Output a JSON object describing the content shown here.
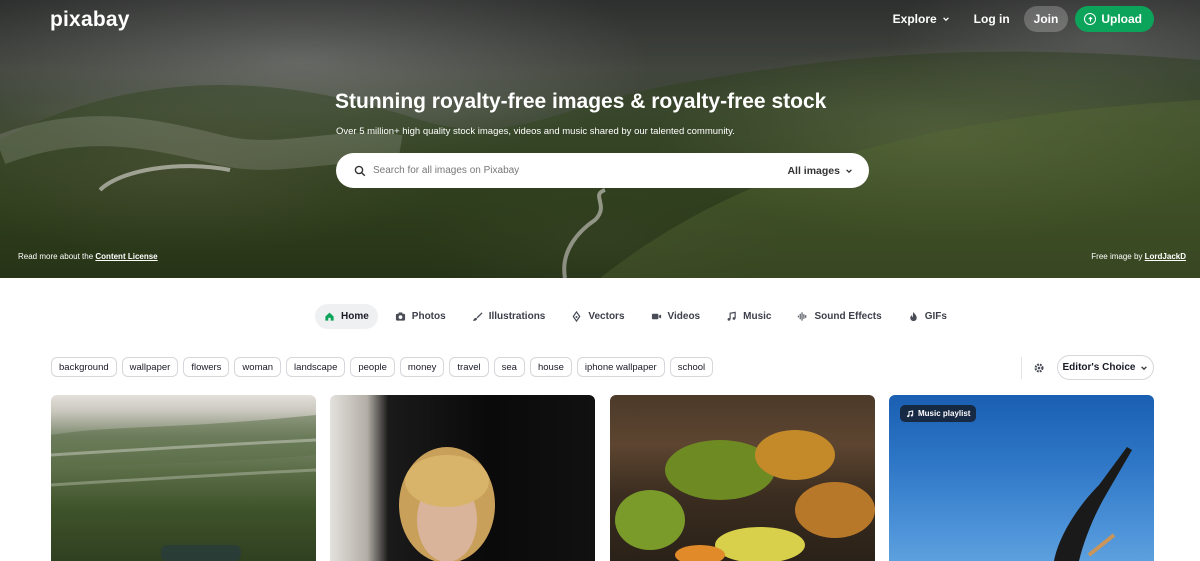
{
  "brand": {
    "logo": "pixabay"
  },
  "nav": {
    "explore": "Explore",
    "login": "Log in",
    "join": "Join",
    "upload": "Upload"
  },
  "hero": {
    "title": "Stunning royalty-free images & royalty-free stock",
    "subtitle": "Over 5 million+ high quality stock images, videos and music shared by our talented community.",
    "search": {
      "placeholder": "Search for all images on Pixabay",
      "type": "All images"
    },
    "license_prefix": "Read more about the ",
    "license_link": "Content License",
    "credit_prefix": "Free image by ",
    "credit_author": "LordJackD"
  },
  "tabs": [
    {
      "label": "Home",
      "icon": "home-icon",
      "active": true
    },
    {
      "label": "Photos",
      "icon": "camera-icon"
    },
    {
      "label": "Illustrations",
      "icon": "brush-icon"
    },
    {
      "label": "Vectors",
      "icon": "pen-nib-icon"
    },
    {
      "label": "Videos",
      "icon": "video-icon"
    },
    {
      "label": "Music",
      "icon": "music-note-icon"
    },
    {
      "label": "Sound Effects",
      "icon": "waveform-icon"
    },
    {
      "label": "GIFs",
      "icon": "flame-icon"
    }
  ],
  "tags": [
    "background",
    "wallpaper",
    "flowers",
    "woman",
    "landscape",
    "people",
    "money",
    "travel",
    "sea",
    "house",
    "iphone wallpaper",
    "school"
  ],
  "sort": {
    "label": "Editor's Choice"
  },
  "gallery": {
    "playlist_badge": "Music playlist"
  },
  "colors": {
    "accent": "#0ca35a",
    "text": "#191b26"
  }
}
